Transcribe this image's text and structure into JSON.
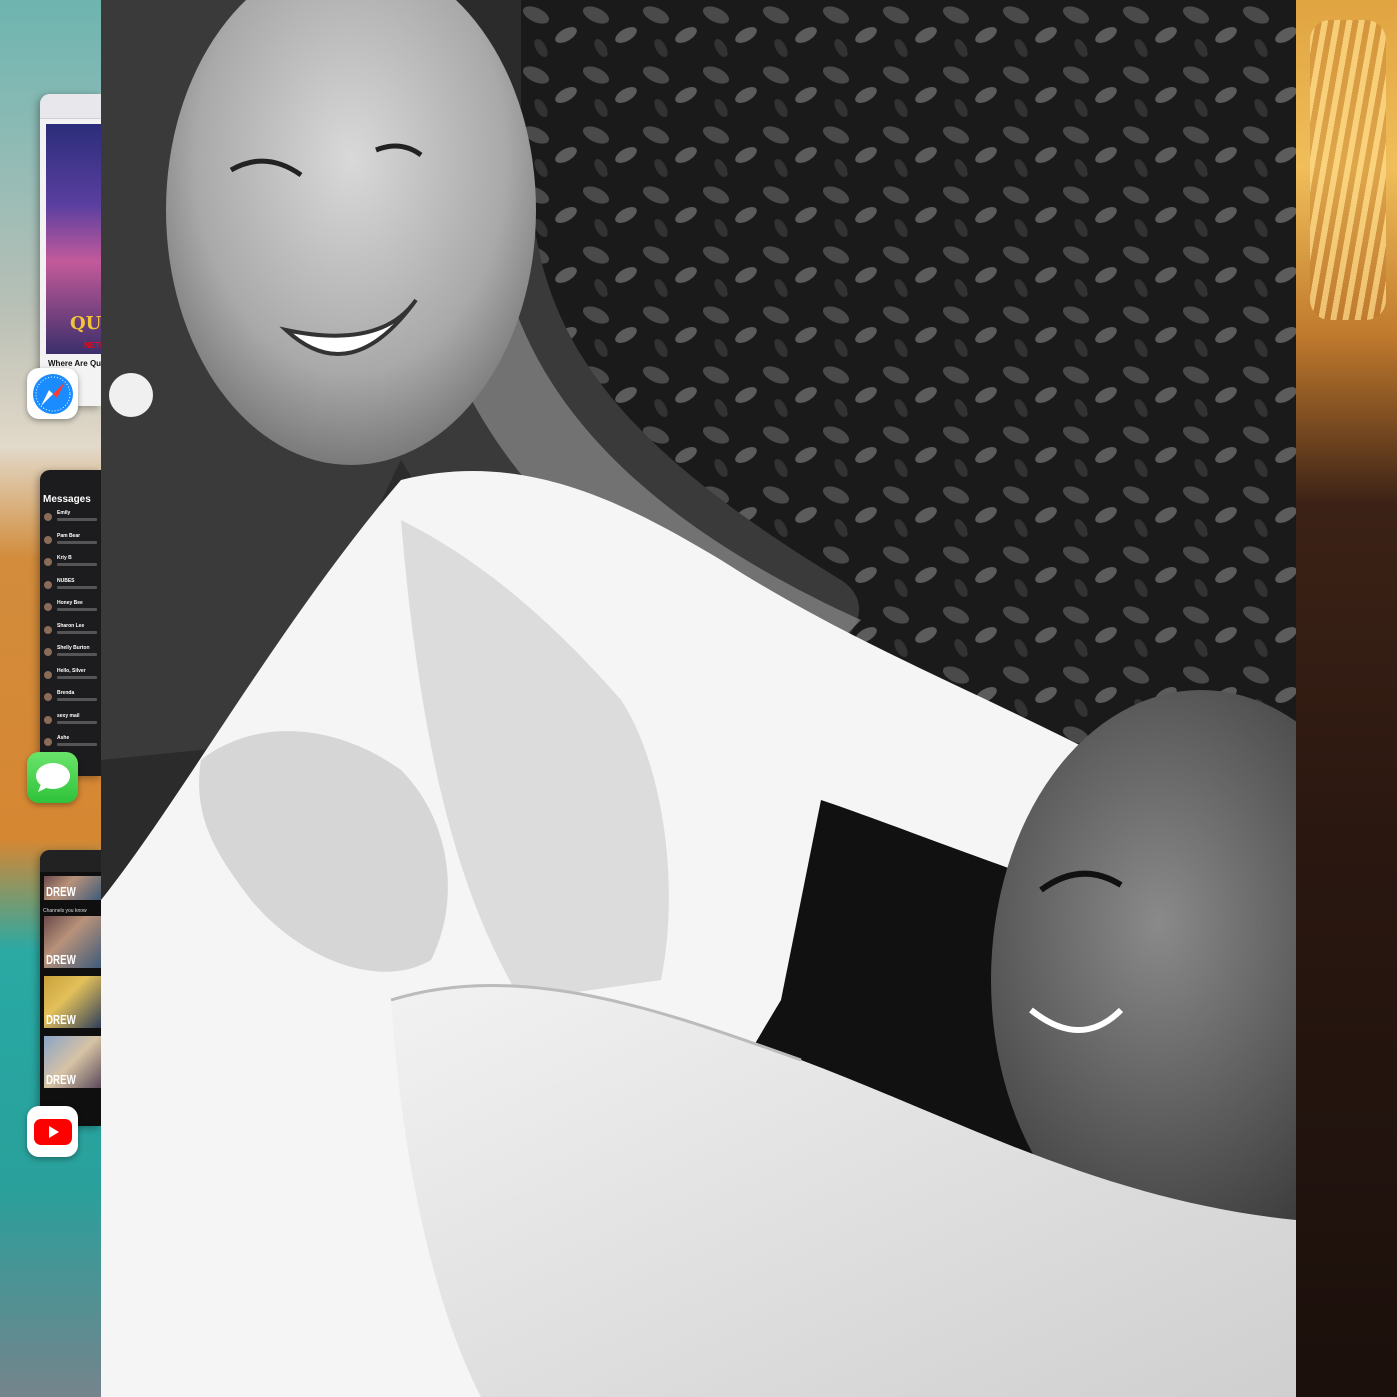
{
  "app_switcher": {
    "apps": [
      {
        "id": "safari",
        "icon": "safari-compass-icon",
        "preview": {
          "poster_title": "QUEE",
          "poster_network": "NETFLIX",
          "headline": "Where Are Queer Eye Sea"
        }
      },
      {
        "id": "messages",
        "icon": "messages-bubble-icon",
        "preview": {
          "title": "Messages",
          "conversations": [
            "Emily",
            "Pam Bear",
            "Kriy B",
            "NUBES",
            "Honey Bee",
            "Sharon Lee",
            "Shelly Burton",
            "Hello, Silver",
            "Brenda",
            "sexy mail",
            "Ashe"
          ]
        }
      },
      {
        "id": "youtube",
        "icon": "youtube-play-icon",
        "preview": {
          "section": "Channels you know",
          "thumbnails": [
            "DREW",
            "DREW",
            "DREW",
            "DREW"
          ]
        }
      }
    ]
  },
  "foreground": {
    "kind": "photo",
    "description_icon": "photo-icon"
  },
  "colors": {
    "messages_green": "#34c759",
    "youtube_red": "#ff0000",
    "safari_blue": "#1a8cff"
  }
}
